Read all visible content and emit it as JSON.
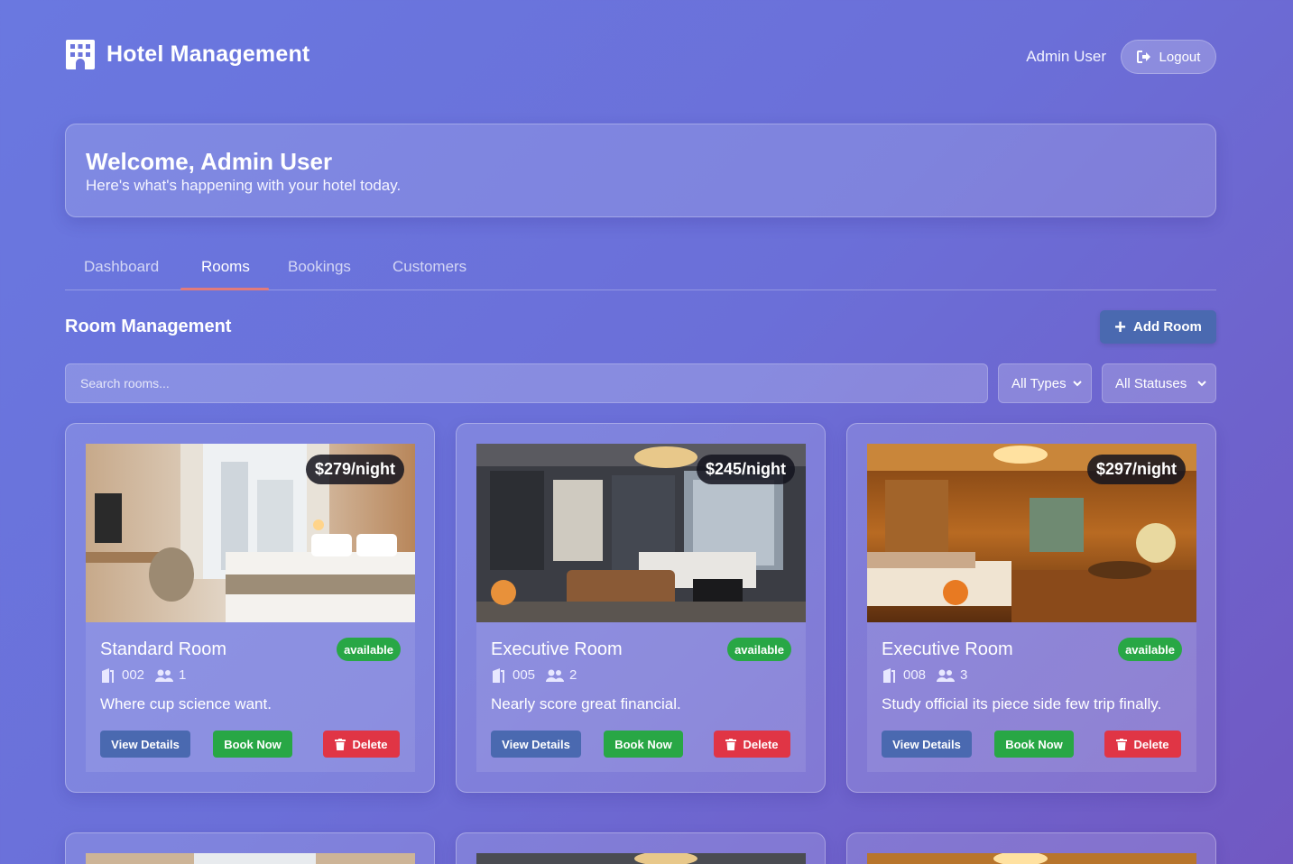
{
  "app": {
    "title": "Hotel Management",
    "icon": "hotel-building-icon"
  },
  "user": {
    "name": "Admin User",
    "logout_label": "Logout"
  },
  "welcome": {
    "heading": "Welcome, Admin User",
    "subtext": "Here's what's happening with your hotel today."
  },
  "tabs": [
    {
      "label": "Dashboard",
      "active": false
    },
    {
      "label": "Rooms",
      "active": true
    },
    {
      "label": "Bookings",
      "active": false
    },
    {
      "label": "Customers",
      "active": false
    }
  ],
  "section": {
    "title": "Room Management",
    "add_label": "Add Room"
  },
  "filters": {
    "search_placeholder": "Search rooms...",
    "type_selected": "All Types",
    "status_selected": "All Statuses"
  },
  "actions": {
    "view": "View Details",
    "book": "Book Now",
    "delete": "Delete"
  },
  "rooms": [
    {
      "price": "$279/night",
      "title": "Standard Room",
      "status": "available",
      "number": "002",
      "capacity": "1",
      "description": "Where cup science want."
    },
    {
      "price": "$245/night",
      "title": "Executive Room",
      "status": "available",
      "number": "005",
      "capacity": "2",
      "description": "Nearly score great financial."
    },
    {
      "price": "$297/night",
      "title": "Executive Room",
      "status": "available",
      "number": "008",
      "capacity": "3",
      "description": "Study official its piece side few trip finally."
    }
  ],
  "colors": {
    "primary_button": "#4a69b0",
    "success": "#28a745",
    "danger": "#e03545",
    "tab_underline": "#e27b7b"
  }
}
